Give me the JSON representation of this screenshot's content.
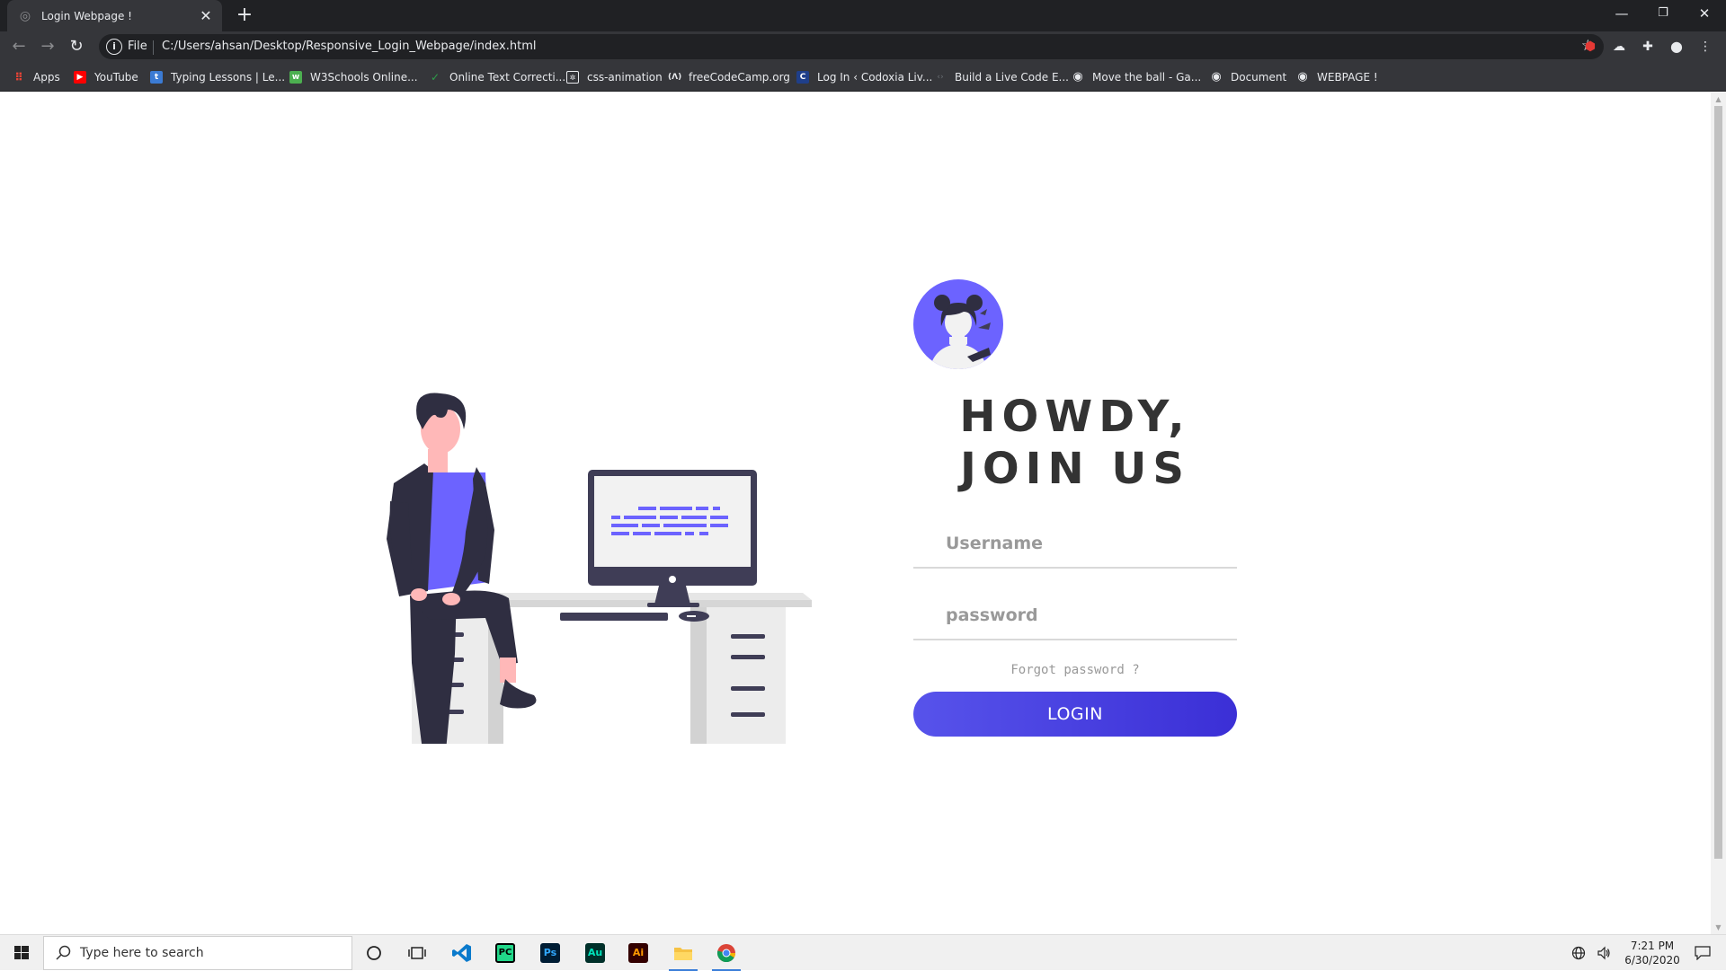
{
  "browser": {
    "tab_title": "Login Webpage !",
    "new_tab": "+",
    "omnibox_scheme": "File",
    "url": "C:/Users/ahsan/Desktop/Responsive_Login_Webpage/index.html",
    "bookmarks": [
      {
        "label": "Apps"
      },
      {
        "label": "YouTube"
      },
      {
        "label": "Typing Lessons | Le..."
      },
      {
        "label": "W3Schools Online..."
      },
      {
        "label": "Online Text Correcti..."
      },
      {
        "label": "css-animation"
      },
      {
        "label": "freeCodeCamp.org"
      },
      {
        "label": "Log In ‹ Codoxia Liv..."
      },
      {
        "label": "Build a Live Code E..."
      },
      {
        "label": "Move the ball - Ga..."
      },
      {
        "label": "Document"
      },
      {
        "label": "WEBPAGE !"
      }
    ]
  },
  "page": {
    "headline_line1": "HOWDY,",
    "headline_line2": "JOIN US",
    "username_placeholder": "Username",
    "password_placeholder": "password",
    "forgot_text": "Forgot password ?",
    "login_label": "LOGIN",
    "colors": {
      "accent": "#6c63ff",
      "button_start": "#5753eb",
      "button_end": "#3b2fd6",
      "dark": "#2f2e41"
    }
  },
  "taskbar": {
    "search_placeholder": "Type here to search",
    "time": "7:21 PM",
    "date": "6/30/2020"
  }
}
